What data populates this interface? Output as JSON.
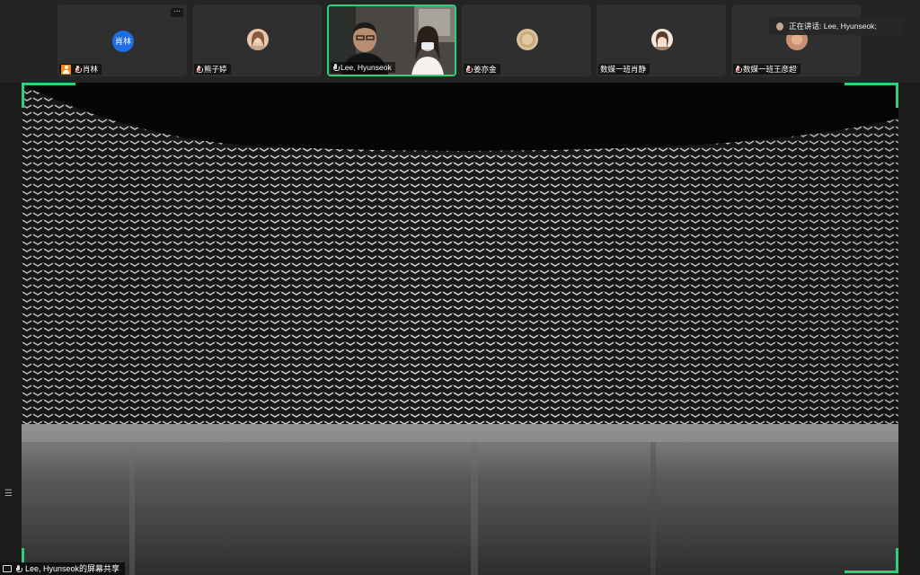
{
  "participants": [
    {
      "name": "肖林",
      "initials": "肖林",
      "kind": "initial",
      "host": true,
      "muted": true
    },
    {
      "name": "熊子婷",
      "kind": "photo",
      "muted": true
    },
    {
      "name": "Lee, Hyunseok",
      "kind": "video",
      "muted": false
    },
    {
      "name": "姜亦金",
      "kind": "photo",
      "muted": true
    },
    {
      "name": "数媒一班肖静",
      "kind": "photo",
      "muted": null
    },
    {
      "name": "数媒一班王彦超",
      "kind": "photo",
      "muted": true
    }
  ],
  "tile_more": "···",
  "speaking_label": "正在讲话: Lee, Hyunseok;",
  "share_label": "Lee, Hyunseok的屏幕共享",
  "colors": {
    "active_border": "#2fd07a",
    "avatar_blue": "#1f6de3",
    "host_orange": "#f28a1c"
  }
}
